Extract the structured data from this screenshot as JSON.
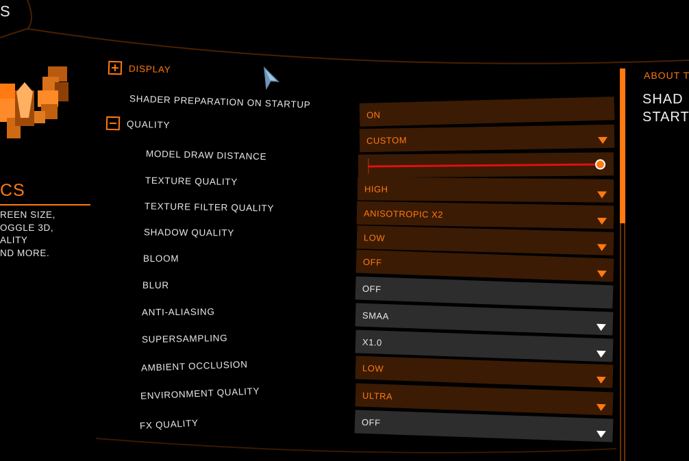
{
  "window": {
    "title_fragment": "S"
  },
  "left_panel": {
    "title_fragment": "CS",
    "description_lines": [
      "REEN SIZE,",
      "OGGLE 3D,",
      "ALITY",
      "ND MORE."
    ]
  },
  "categories": {
    "display": {
      "label": "DISPLAY",
      "state": "collapsed"
    },
    "quality": {
      "label": "QUALITY",
      "state": "expanded"
    }
  },
  "settings": [
    {
      "label": "SHADER PREPARATION ON STARTUP",
      "value": "ON",
      "control": "toggle",
      "style": "orange"
    },
    {
      "label": "QUALITY",
      "value": "CUSTOM",
      "control": "dropdown",
      "style": "orange"
    },
    {
      "label": "MODEL DRAW DISTANCE",
      "value": "",
      "control": "slider",
      "style": "orange",
      "level_fraction": 1.0
    },
    {
      "label": "TEXTURE QUALITY",
      "value": "HIGH",
      "control": "dropdown",
      "style": "orange"
    },
    {
      "label": "TEXTURE FILTER QUALITY",
      "value": "ANISOTROPIC X2",
      "control": "dropdown",
      "style": "orange"
    },
    {
      "label": "SHADOW QUALITY",
      "value": "LOW",
      "control": "dropdown",
      "style": "orange"
    },
    {
      "label": "BLOOM",
      "value": "OFF",
      "control": "dropdown",
      "style": "orange"
    },
    {
      "label": "BLUR",
      "value": "OFF",
      "control": "toggle",
      "style": "grey"
    },
    {
      "label": "ANTI-ALIASING",
      "value": "SMAA",
      "control": "dropdown",
      "style": "grey"
    },
    {
      "label": "SUPERSAMPLING",
      "value": "X1.0",
      "control": "dropdown",
      "style": "grey"
    },
    {
      "label": "AMBIENT OCCLUSION",
      "value": "LOW",
      "control": "dropdown",
      "style": "orange"
    },
    {
      "label": "ENVIRONMENT QUALITY",
      "value": "ULTRA",
      "control": "dropdown",
      "style": "orange"
    },
    {
      "label": "FX QUALITY",
      "value": "OFF",
      "control": "dropdown",
      "style": "grey"
    }
  ],
  "right_panel": {
    "label": "ABOUT T",
    "title": "SHAD\nSTART"
  },
  "icons": {
    "expand": "plus-box-icon",
    "collapse": "minus-box-icon",
    "dropdown": "triangle-down-icon",
    "logo": "elite-wings-logo",
    "cursor": "arrow-cursor-icon"
  },
  "colors": {
    "accent": "#ff7a10",
    "row_orange_bg": "#3b1b04",
    "row_grey_bg": "#2d2d2d",
    "slider_track": "#e01010",
    "text": "#e6e6e6"
  }
}
